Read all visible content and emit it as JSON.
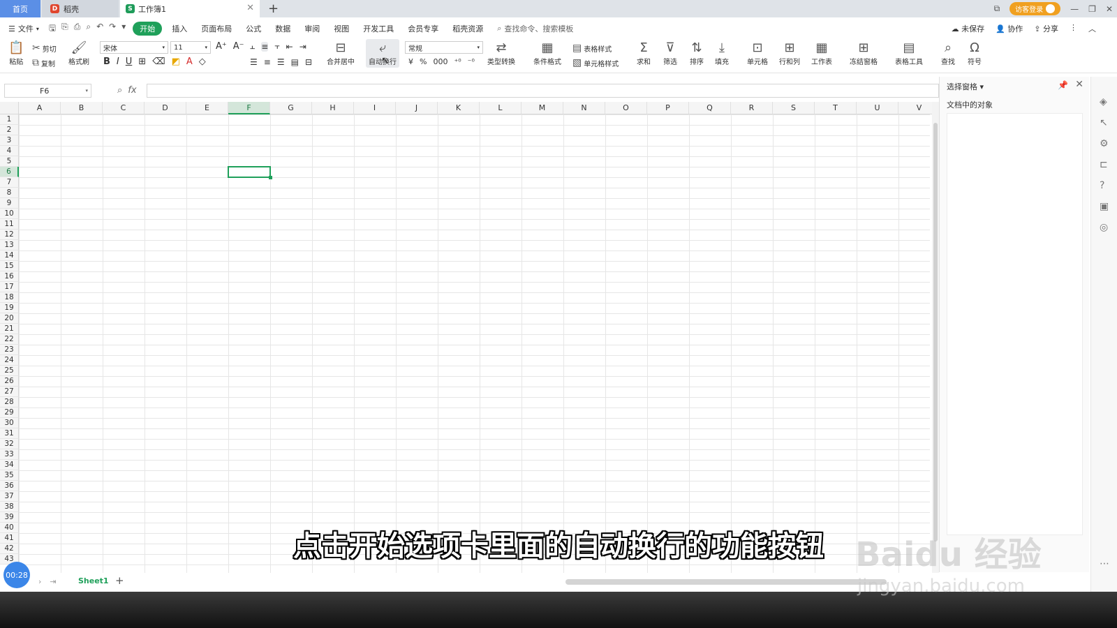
{
  "tabs": {
    "home": "首页",
    "doc": "稻壳",
    "workbook": "工作簿1"
  },
  "window": {
    "login": "访客登录"
  },
  "menu": {
    "file": "文件",
    "items": [
      "开始",
      "插入",
      "页面布局",
      "公式",
      "数据",
      "审阅",
      "视图",
      "开发工具",
      "会员专享",
      "稻壳资源"
    ],
    "search_placeholder": "查找命令、搜索模板",
    "right": [
      "未保存",
      "协作",
      "分享"
    ]
  },
  "ribbon": {
    "paste": "粘贴",
    "cut": "剪切",
    "copy": "复制",
    "format_painter": "格式刷",
    "font_name": "宋体",
    "font_size": "11",
    "merge": "合并居中",
    "wrap": "自动换行",
    "number_format": "常规",
    "type_convert": "类型转换",
    "cond_format": "条件格式",
    "table_style": "表格样式",
    "cell_style": "单元格样式",
    "sum": "求和",
    "filter": "筛选",
    "sort": "排序",
    "fill": "填充",
    "cell": "单元格",
    "rowcol": "行和列",
    "worksheet": "工作表",
    "freeze": "冻结窗格",
    "table_tools": "表格工具",
    "find": "查找",
    "symbol": "符号"
  },
  "formula_bar": {
    "name_box": "F6",
    "fx": "fx",
    "formula": ""
  },
  "grid": {
    "columns": [
      "A",
      "B",
      "C",
      "D",
      "E",
      "F",
      "G",
      "H",
      "I",
      "J",
      "K",
      "L",
      "M",
      "N",
      "O",
      "P",
      "Q",
      "R",
      "S",
      "T",
      "U",
      "V"
    ],
    "selected_col": "F",
    "selected_row": "6",
    "rows": [
      "1",
      "2",
      "3",
      "4",
      "5",
      "6",
      "7",
      "8",
      "9",
      "10",
      "11",
      "12",
      "13",
      "14",
      "15",
      "16",
      "17",
      "18",
      "19",
      "20",
      "21",
      "22",
      "23",
      "24",
      "25",
      "26",
      "27",
      "28",
      "29",
      "30",
      "31",
      "32",
      "33",
      "34",
      "35",
      "36",
      "37",
      "38",
      "39",
      "40",
      "41",
      "42",
      "43"
    ]
  },
  "right_pane": {
    "title": "选择窗格",
    "subtitle": "文档中的对象"
  },
  "sheets": {
    "active": "Sheet1"
  },
  "overlay": {
    "timer": "00:28",
    "subtitle": "点击开始选项卡里面的自动换行的功能按钮",
    "watermark": "Baidu 经验",
    "watermark_url": "jingyan.baidu.com"
  },
  "colors": {
    "accent": "#1fa05a",
    "home_tab": "#5b8fe6",
    "login": "#f0a020"
  }
}
